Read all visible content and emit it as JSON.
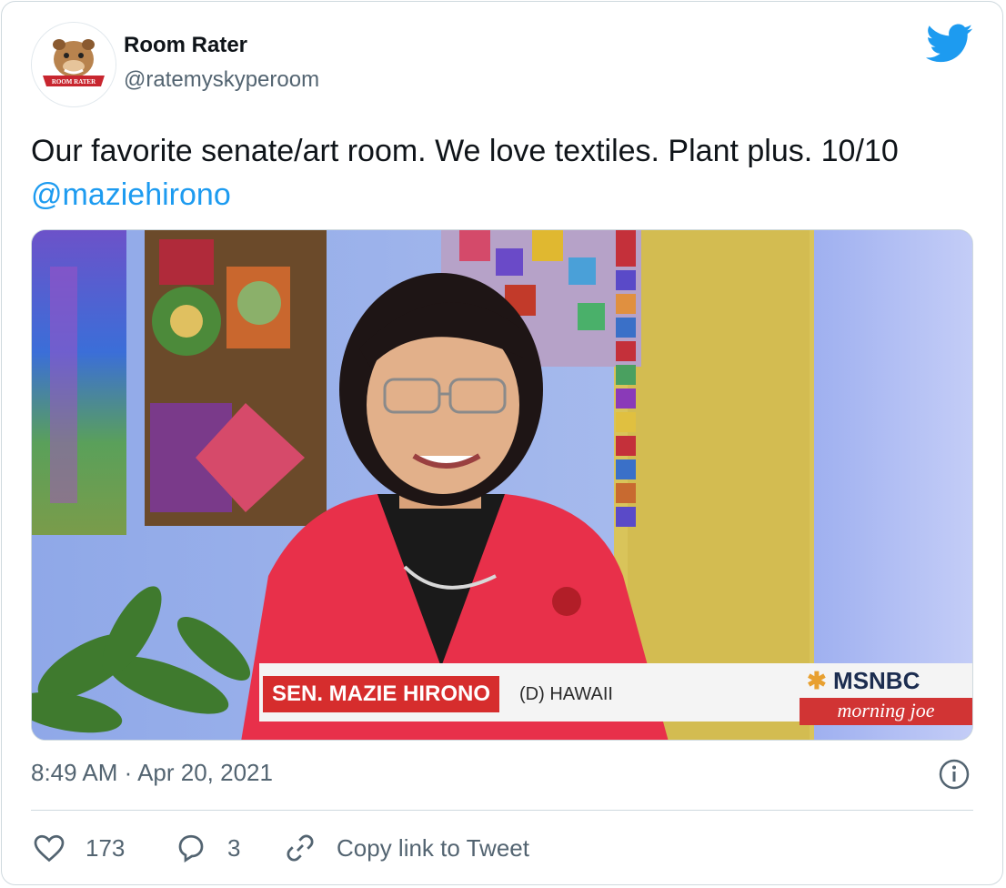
{
  "account": {
    "display_name": "Room Rater",
    "handle": "@ratemyskyperoom",
    "avatar_text": "ROOM RATER"
  },
  "tweet": {
    "text": "Our favorite senate/art room. We love textiles. Plant plus. 10/10",
    "mention": "@maziehirono",
    "timestamp": "8:49 AM · Apr 20, 2021"
  },
  "media": {
    "chyron_name": "SEN. MAZIE HIRONO",
    "chyron_state": "(D) HAWAII",
    "network": "MSNBC",
    "show": "morning joe"
  },
  "actions": {
    "like_count": "173",
    "reply_count": "3",
    "copy_link_label": "Copy link to Tweet"
  },
  "colors": {
    "accent": "#1d9bf0",
    "text_secondary": "#536471",
    "chyron_red": "#d62d2d"
  },
  "icons": [
    "twitter-bird-icon",
    "info-icon",
    "heart-icon",
    "reply-bubble-icon",
    "link-icon"
  ]
}
